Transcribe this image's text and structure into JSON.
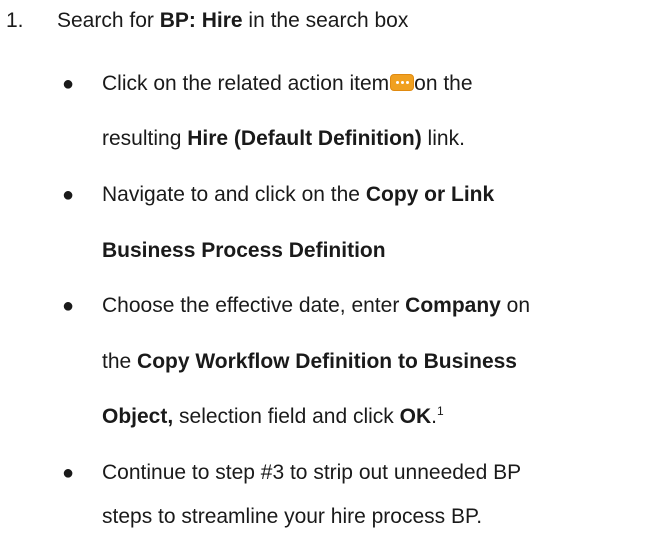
{
  "step": {
    "number": "1.",
    "pre": "Search for ",
    "bold": "BP: Hire",
    "post": " in the search box"
  },
  "bullet_glyph": "●",
  "bullets": [
    {
      "lines": [
        {
          "pre": "Click on the related action item",
          "icon": "more-actions-icon",
          "post": "on the"
        },
        {
          "pre": "resulting ",
          "bold": "Hire (Default Definition)",
          "post": " link."
        }
      ]
    },
    {
      "lines": [
        {
          "pre": "Navigate to and click on the ",
          "bold": "Copy or Link"
        },
        {
          "bold": "Business Process Definition"
        }
      ]
    },
    {
      "lines": [
        {
          "pre": "Choose the effective date, enter ",
          "bold": "Company",
          "post": " on"
        },
        {
          "pre": "the ",
          "bold": "Copy Workflow Definition to Business"
        },
        {
          "bold": "Object,",
          "mid": " selection field and click ",
          "bold2": "OK",
          "post": ".",
          "sup": "1"
        }
      ]
    },
    {
      "lines": [
        {
          "pre": "Continue to step #3 to strip out unneeded BP"
        },
        {
          "pre": "steps to streamline your hire process BP."
        }
      ]
    }
  ],
  "colors": {
    "text": "#1a1a1a",
    "icon_fill": "#f0a020"
  }
}
